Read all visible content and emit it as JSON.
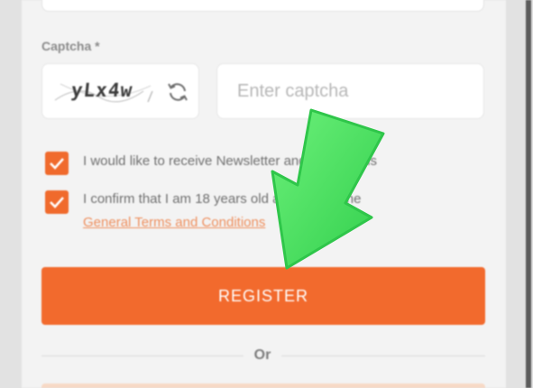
{
  "form": {
    "captcha_label": "Captcha *",
    "captcha_code": "yLx4w",
    "captcha_placeholder": "Enter captcha",
    "captcha_value": "",
    "checkboxes": [
      {
        "text": "I would like to receive Newsletter and promotions",
        "checked": true
      },
      {
        "text": "I confirm that I am 18 years old and accept the",
        "link": "General Terms and Conditions",
        "checked": true
      }
    ],
    "register_label": "REGISTER",
    "divider_text": "Or"
  },
  "colors": {
    "accent": "#f26a2d",
    "link": "#ee8f5e",
    "overlay_arrow": "#45e05e"
  },
  "icons": {
    "refresh": "refresh-icon",
    "check": "checkmark-icon",
    "overlay": "pointer-arrow-icon"
  }
}
